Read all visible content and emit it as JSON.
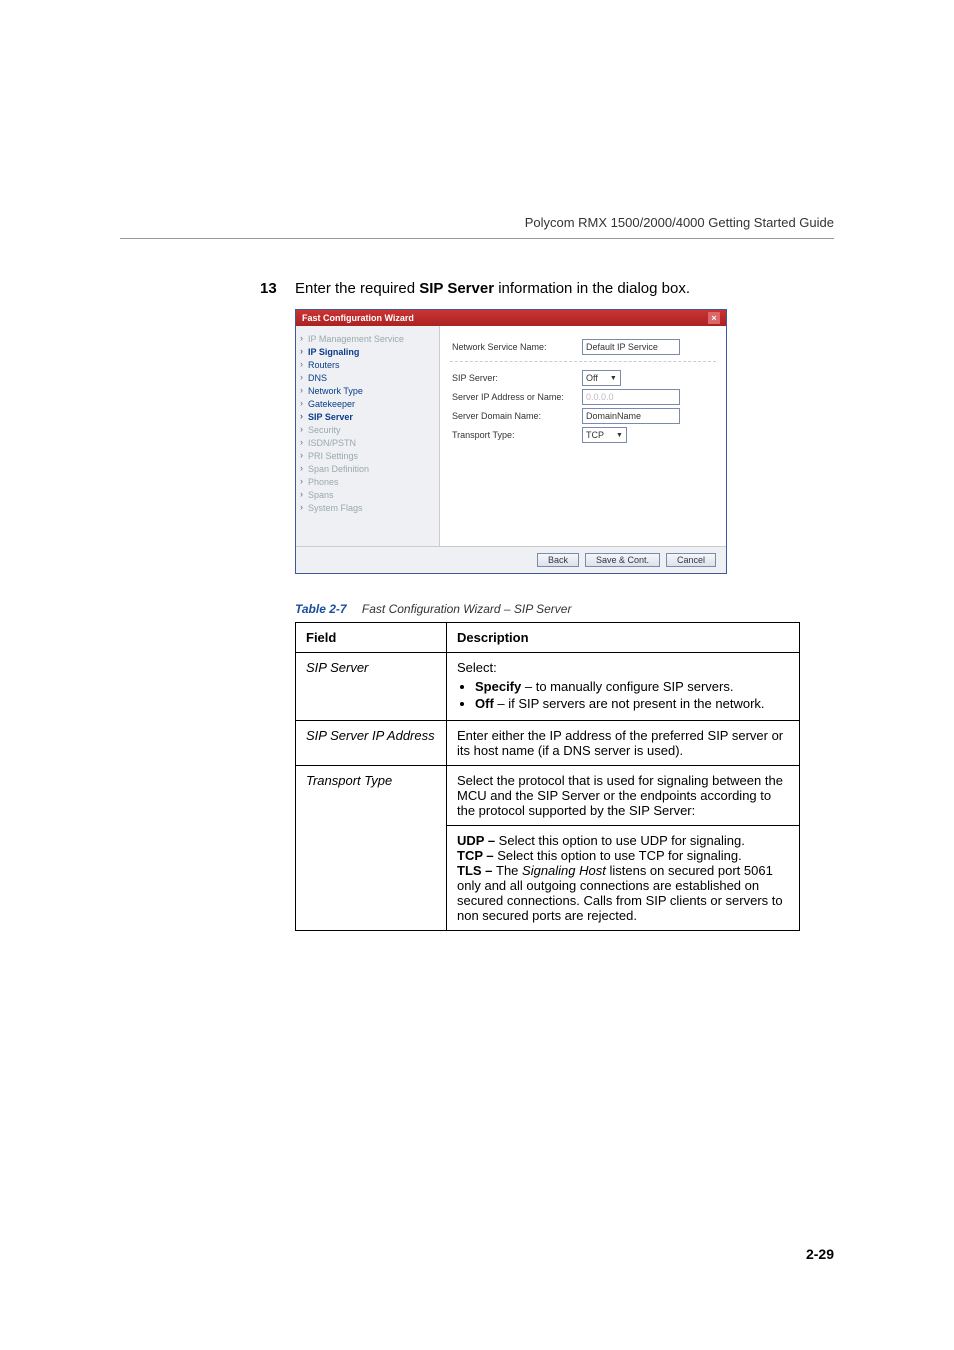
{
  "header": {
    "guide": "Polycom RMX 1500/2000/4000 Getting Started Guide"
  },
  "step": {
    "number": "13",
    "pre": "Enter the required ",
    "bold": "SIP Server",
    "post": " information in the dialog box."
  },
  "wizard": {
    "title": "Fast Configuration Wizard",
    "nav": {
      "ip_mgmt": "IP Management Service",
      "ip_sig": "IP Signaling",
      "routers": "Routers",
      "dns": "DNS",
      "net_type": "Network Type",
      "gatekeeper": "Gatekeeper",
      "sip_server": "SIP Server",
      "security": "Security",
      "isdn": "ISDN/PSTN",
      "pri": "PRI Settings",
      "span_def": "Span Definition",
      "phones": "Phones",
      "spans": "Spans",
      "flags": "System Flags"
    },
    "fields": {
      "svc_name_label": "Network Service Name:",
      "svc_name_value": "Default IP Service",
      "sip_label": "SIP Server:",
      "sip_value": "Off",
      "server_ip_label": "Server IP Address or Name:",
      "server_ip_value": "0.0.0.0",
      "domain_label": "Server Domain Name:",
      "domain_value": "DomainName",
      "transport_label": "Transport Type:",
      "transport_value": "TCP"
    },
    "buttons": {
      "back": "Back",
      "save": "Save & Cont.",
      "cancel": "Cancel"
    }
  },
  "table": {
    "caption_num": "Table 2-7",
    "caption_title": "Fast Configuration Wizard – SIP Server",
    "head_field": "Field",
    "head_desc": "Description",
    "row1": {
      "field": "SIP Server",
      "select": "Select:",
      "specify_b": "Specify",
      "specify_rest": " – to manually configure SIP servers.",
      "off_b": "Off",
      "off_rest": " – if SIP servers are not present in the network."
    },
    "row2": {
      "field": "SIP Server IP Address",
      "desc": "Enter either the IP address of the preferred SIP server or its host name (if a DNS server is used)."
    },
    "row3": {
      "field": "Transport Type",
      "desc": "Select the protocol that is used for signaling between the MCU and the SIP Server or the endpoints according to the protocol supported by the SIP Server:",
      "udp_b": "UDP – ",
      "udp_rest": "Select this option to use UDP for signaling.",
      "tcp_b": "TCP – ",
      "tcp_rest": "Select this option to use TCP for signaling.",
      "tls_b": "TLS – ",
      "tls_pre": "The ",
      "tls_it": "Signaling Host",
      "tls_rest": " listens on secured port 5061 only and all outgoing connections are established on secured connections. Calls from SIP clients or servers to non secured ports are rejected."
    }
  },
  "page": "2-29"
}
